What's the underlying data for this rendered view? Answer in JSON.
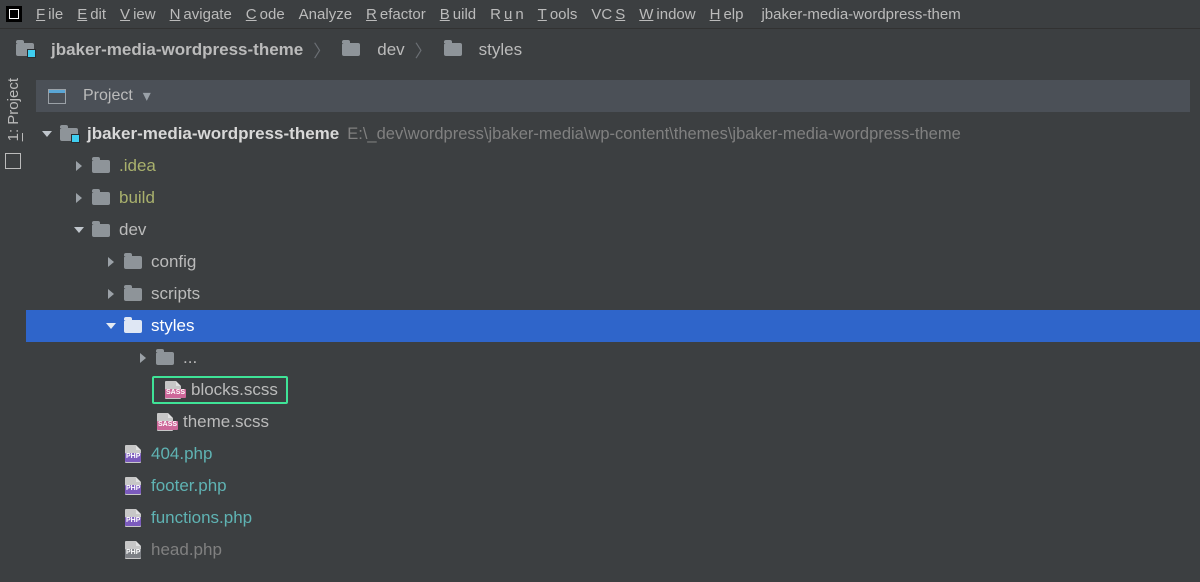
{
  "window_title": "jbaker-media-wordpress-them",
  "menu": {
    "file": {
      "u": "F",
      "rest": "ile"
    },
    "edit": {
      "u": "E",
      "rest": "dit"
    },
    "view": {
      "u": "V",
      "rest": "iew"
    },
    "navigate": {
      "u": "N",
      "rest": "avigate"
    },
    "code": {
      "u": "C",
      "rest": "ode"
    },
    "analyze": {
      "rest": "Analyze",
      "u": ""
    },
    "refactor": {
      "u": "R",
      "rest": "efactor"
    },
    "build": {
      "u": "B",
      "rest": "uild"
    },
    "run": {
      "pre": "R",
      "u": "u",
      "rest": "n"
    },
    "tools": {
      "u": "T",
      "rest": "ools"
    },
    "vcs": {
      "pre": "VC",
      "u": "S",
      "rest": ""
    },
    "window": {
      "u": "W",
      "rest": "indow"
    },
    "help": {
      "u": "H",
      "rest": "elp"
    }
  },
  "breadcrumbs": {
    "root": "jbaker-media-wordpress-theme",
    "dev": "dev",
    "styles": "styles"
  },
  "sidebar": {
    "tool_label_u": "1",
    "tool_label_rest": ": Project"
  },
  "panel_title": "Project",
  "tree": {
    "root": {
      "name": "jbaker-media-wordpress-theme",
      "path": "E:\\_dev\\wordpress\\jbaker-media\\wp-content\\themes\\jbaker-media-wordpress-theme"
    },
    "idea": ".idea",
    "build": "build",
    "dev": "dev",
    "config": "config",
    "scripts": "scripts",
    "styles": "styles",
    "ellipsis": "...",
    "blocks": "blocks.scss",
    "theme": "theme.scss",
    "f404": "404.php",
    "footer": "footer.php",
    "functions": "functions.php",
    "head": "head.php"
  },
  "icons": {
    "sass": "SASS",
    "php": "PHP"
  }
}
